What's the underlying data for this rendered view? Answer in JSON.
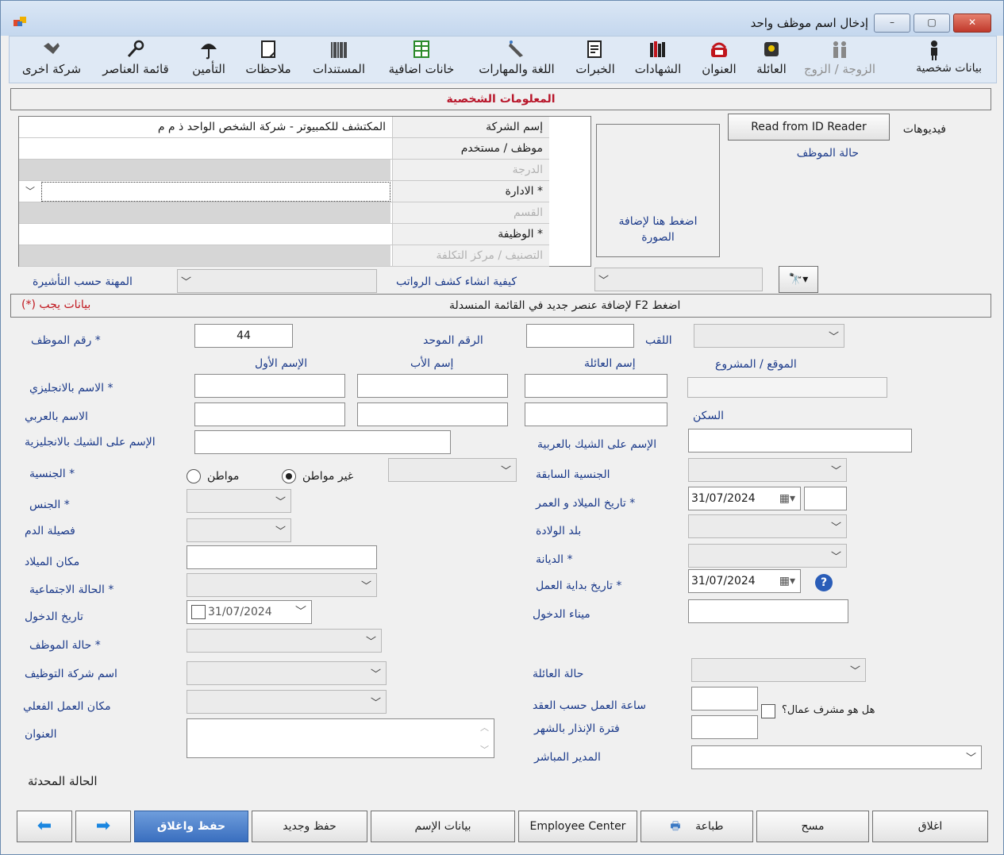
{
  "window": {
    "title": "إدخال اسم موظف واحد",
    "min": "–",
    "max": "▢",
    "close": "✕"
  },
  "toolbar": [
    {
      "label": "بيانات شخصية",
      "icon": "person-icon",
      "state": "sel"
    },
    {
      "label": "الزوجة / الزوج",
      "icon": "couple-icon",
      "state": "dis"
    },
    {
      "label": "العائلة",
      "icon": "family-icon",
      "state": ""
    },
    {
      "label": "العنوان",
      "icon": "phone-icon",
      "state": ""
    },
    {
      "label": "الشهادات",
      "icon": "books-icon",
      "state": ""
    },
    {
      "label": "الخبرات",
      "icon": "certificate-icon",
      "state": ""
    },
    {
      "label": "اللغة والمهارات",
      "icon": "pen-icon",
      "state": ""
    },
    {
      "label": "خانات اضافية",
      "icon": "grid-icon",
      "state": ""
    },
    {
      "label": "المستندات",
      "icon": "barcode-icon",
      "state": ""
    },
    {
      "label": "ملاحظات",
      "icon": "note-icon",
      "state": ""
    },
    {
      "label": "التأمين",
      "icon": "umbrella-icon",
      "state": ""
    },
    {
      "label": "قائمة العناصر",
      "icon": "wrench-icon",
      "state": ""
    },
    {
      "label": "شركة اخرى",
      "icon": "handshake-icon",
      "state": ""
    }
  ],
  "section": {
    "title": "المعلومات الشخصية",
    "hint": "اضغط F2 لإضافة عنصر جديد في القائمة المنسدلة",
    "required": "بيانات يجب (*)"
  },
  "grid": [
    {
      "label": "إسم الشركة",
      "value": "المكتشف للكمبيوتر - شركة الشخص الواحد ذ م م",
      "star": "",
      "state": "norm"
    },
    {
      "label": "موظف / مستخدم",
      "value": "",
      "star": "",
      "state": "norm"
    },
    {
      "label": "الدرجة",
      "value": "",
      "star": "",
      "state": "dis"
    },
    {
      "label": "الادارة",
      "value": "",
      "star": "*",
      "state": "combo"
    },
    {
      "label": "القسم",
      "value": "",
      "star": "",
      "state": "dis"
    },
    {
      "label": "الوظيفة",
      "value": "",
      "star": "*",
      "state": "norm"
    },
    {
      "label": "التصنيف / مركز التكلفة",
      "value": "",
      "star": "",
      "state": "dis"
    }
  ],
  "photo": {
    "text1": "اضغط هنا لإضافة",
    "text2": "الصورة"
  },
  "right_panel": {
    "id_reader": "Read from ID Reader",
    "videos": "فيديوهات",
    "emp_status": "حالة الموظف"
  },
  "under_grid": {
    "profession": "المهنة حسب التأشيرة",
    "payroll": "كيفية انشاء كشف الرواتب"
  },
  "form": {
    "emp_no": "رقم الموظف",
    "emp_no_value": "44",
    "unified": "الرقم الموحد",
    "title": "اللقب",
    "first": "الإسم الأول",
    "father": "إسم الأب",
    "family": "إسم العائلة",
    "site": "الموقع / المشروع",
    "name_en": "الاسم بالانجليزي",
    "name_ar": "الاسم بالعربي",
    "housing": "السكن",
    "cheque_en": "الإسم على الشيك بالانجليزية",
    "cheque_ar": "الإسم على الشيك بالعربية",
    "nationality": "الجنسية",
    "citizen": "مواطن",
    "non_citizen": "غير مواطن",
    "prev_nat": "الجنسية السابقة",
    "gender": "الجنس",
    "dob_age": "تاريخ الميلاد و العمر",
    "dob": "31/07/2024",
    "blood": "فصيلة الدم",
    "birth_country": "بلد الولادة",
    "birth_place": "مكان الميلاد",
    "religion": "الديانة",
    "marital": "الحالة الاجتماعية",
    "start_date_lbl": "تاريخ بداية العمل",
    "start_date": "31/07/2024",
    "entry_date_lbl": "تاريخ الدخول",
    "entry_date": "31/07/2024",
    "entry_port": "ميناء الدخول",
    "emp_state": "حالة الموظف",
    "sponsor": "اسم شركة التوظيف",
    "family_state": "حالة العائلة",
    "actual_place": "مكان العمل الفعلي",
    "contract_hours": "ساعة العمل حسب العقد",
    "supervisor_q": "هل هو مشرف عمال؟",
    "address": "العنوان",
    "notice": "فترة الإنذار بالشهر",
    "manager": "المدير المباشر",
    "updated": "الحالة المحدثة"
  },
  "buttons": {
    "close": "اغلاق",
    "clear": "مسح",
    "print": "طباعة",
    "center": "Employee Center",
    "name_data": "بيانات الإسم",
    "save_new": "حفظ وجديد",
    "save_close": "حفظ واغلاق"
  }
}
